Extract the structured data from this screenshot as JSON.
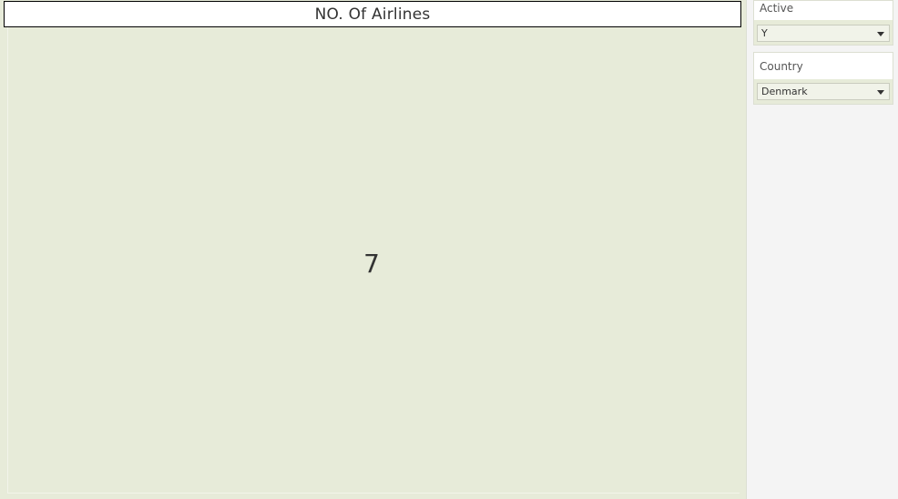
{
  "worksheet": {
    "title": "NO. Of Airlines",
    "kpi_value": "7"
  },
  "filters": {
    "active": {
      "label": "Active",
      "selected": "Y"
    },
    "country": {
      "label": "Country",
      "selected": "Denmark"
    }
  },
  "colors": {
    "canvas_background": "#e7ebd9",
    "panel_background": "#f4f4f4",
    "title_border": "#000000",
    "text": "#333333"
  },
  "icons": {
    "dropdown": "chevron-down-icon"
  }
}
